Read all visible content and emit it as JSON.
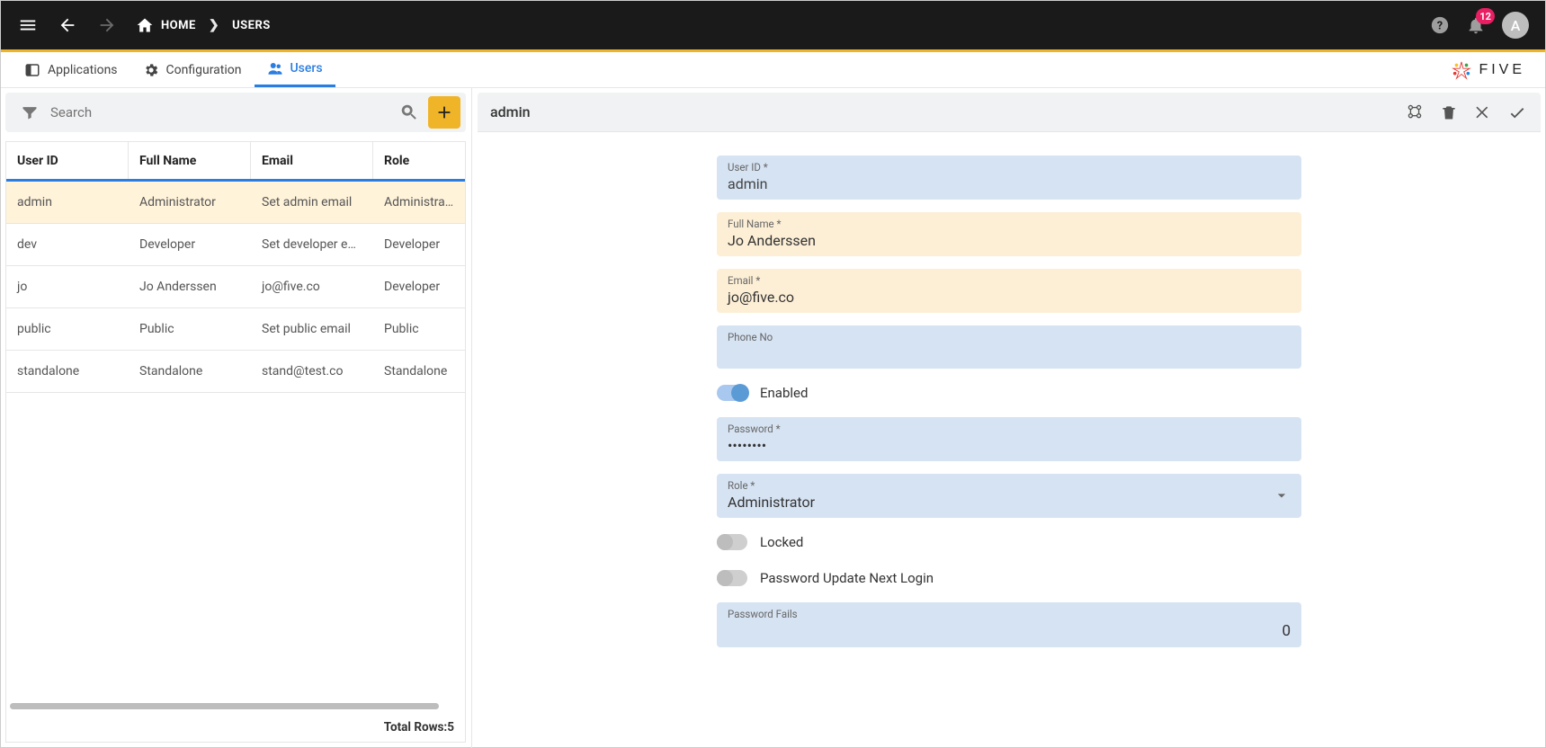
{
  "toolbar": {
    "home": "HOME",
    "current": "USERS",
    "notif_count": "12",
    "avatar_letter": "A"
  },
  "tabs": {
    "applications": "Applications",
    "configuration": "Configuration",
    "users": "Users"
  },
  "logo_text": "FIVE",
  "search": {
    "placeholder": "Search"
  },
  "columns": {
    "c1": "User ID",
    "c2": "Full Name",
    "c3": "Email",
    "c4": "Role"
  },
  "rows": [
    {
      "id": "admin",
      "name": "Administrator",
      "email": "Set admin email",
      "role": "Administrator"
    },
    {
      "id": "dev",
      "name": "Developer",
      "email": "Set developer em…",
      "role": "Developer"
    },
    {
      "id": "jo",
      "name": "Jo Anderssen",
      "email": "jo@five.co",
      "role": "Developer"
    },
    {
      "id": "public",
      "name": "Public",
      "email": "Set public email",
      "role": "Public"
    },
    {
      "id": "standalone",
      "name": "Standalone",
      "email": "stand@test.co",
      "role": "Standalone"
    }
  ],
  "footer": {
    "total_label": "Total Rows: ",
    "total": "5"
  },
  "detail": {
    "title": "admin",
    "fields": {
      "user_id": {
        "label": "User ID *",
        "value": "admin"
      },
      "full_name": {
        "label": "Full Name *",
        "value": "Jo Anderssen"
      },
      "email": {
        "label": "Email *",
        "value": "jo@five.co"
      },
      "phone": {
        "label": "Phone No",
        "value": ""
      },
      "enabled": {
        "label": "Enabled",
        "value": true
      },
      "password": {
        "label": "Password *",
        "value": "••••••••"
      },
      "role": {
        "label": "Role *",
        "value": "Administrator"
      },
      "locked": {
        "label": "Locked",
        "value": false
      },
      "pwd_next": {
        "label": "Password Update Next Login",
        "value": false
      },
      "pwd_fails": {
        "label": "Password Fails",
        "value": "0"
      }
    }
  }
}
